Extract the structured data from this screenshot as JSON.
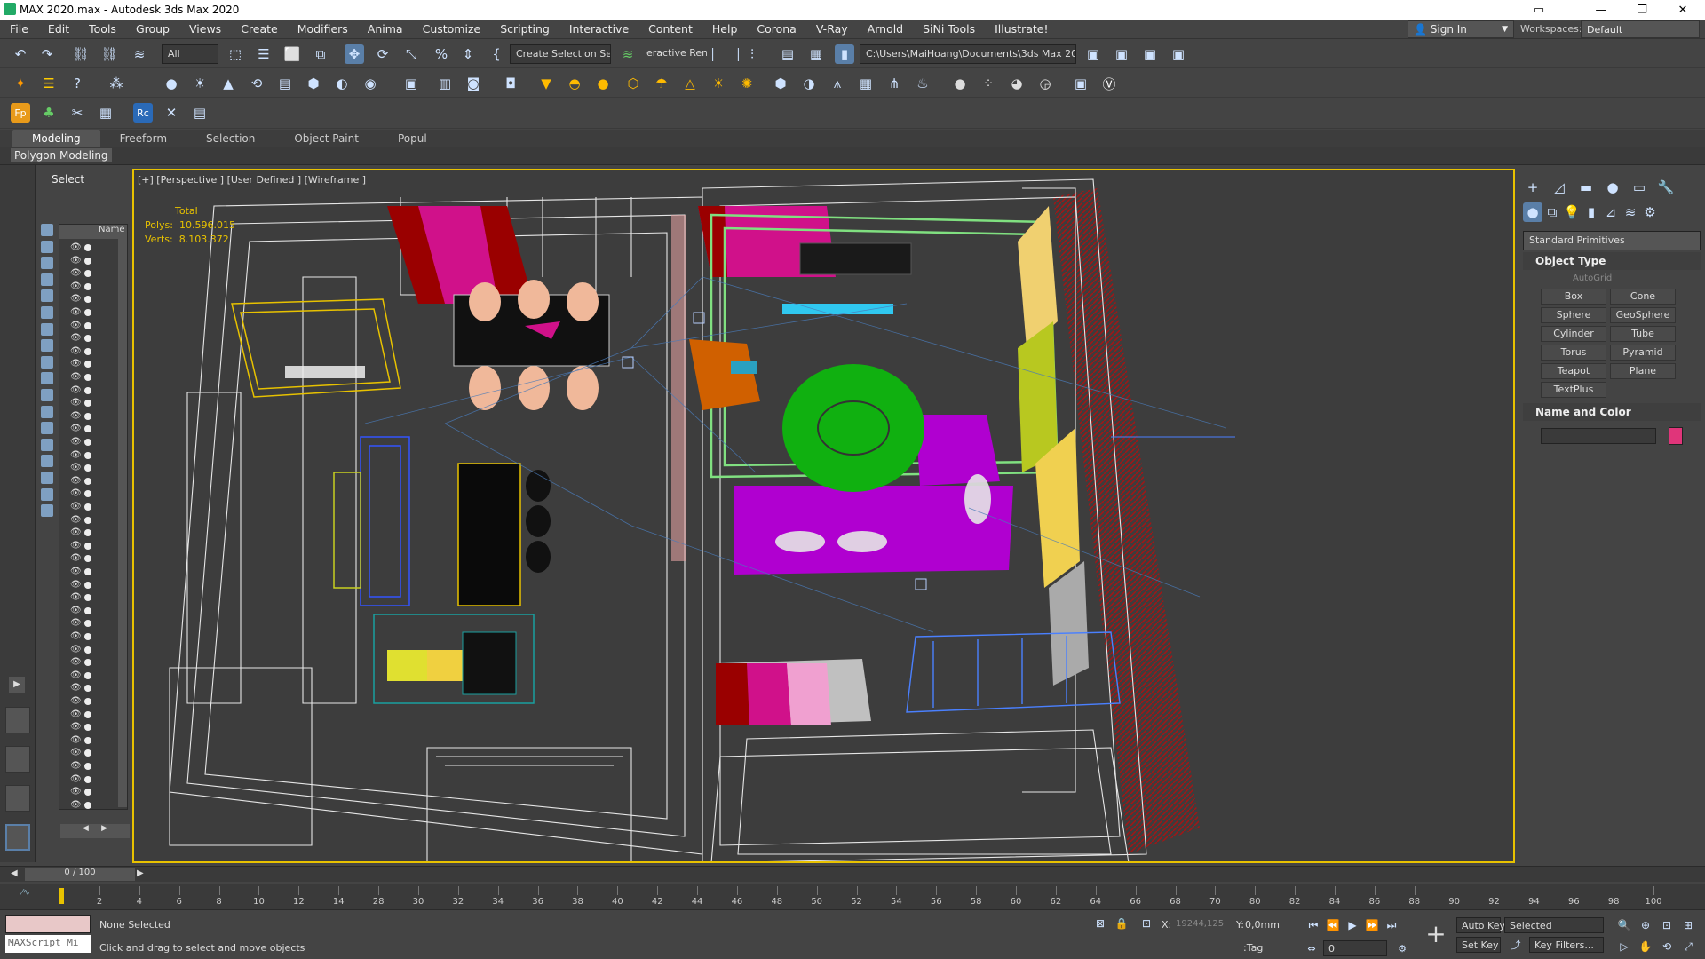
{
  "window": {
    "title": "MAX 2020.max - Autodesk 3ds Max 2020"
  },
  "menu": [
    "File",
    "Edit",
    "Tools",
    "Group",
    "Views",
    "Create",
    "Modifiers",
    "Anima",
    "Customize",
    "Scripting",
    "Interactive",
    "Content",
    "Help",
    "Corona",
    "V-Ray",
    "Arnold",
    "SiNi Tools",
    "Illustrate!"
  ],
  "account": {
    "signin": "Sign In",
    "workspaces_label": "Workspaces:",
    "workspace": "Default"
  },
  "toolbar": {
    "filter": "All",
    "selection_set": "Create Selection Se",
    "interactive": "eractive Rend",
    "path": "C:\\Users\\MaiHoang\\Documents\\3ds Max 2020"
  },
  "ribbon": {
    "tabs": [
      "Modeling",
      "Freeform",
      "Selection",
      "Object Paint",
      "Popul"
    ],
    "active": "Modeling",
    "panel": "Polygon Modeling"
  },
  "scene_explorer": {
    "title": "Select",
    "column": "Name (Sorted A"
  },
  "viewport": {
    "label": "[+] [Perspective ] [User Defined ] [Wireframe ]",
    "stats": {
      "total": "Total",
      "polys_label": "Polys:",
      "polys": "10.596.015",
      "verts_label": "Verts:",
      "verts": "8.103.372"
    }
  },
  "command_panel": {
    "category": "Standard Primitives",
    "object_type": "Object Type",
    "autogrid": "AutoGrid",
    "buttons": [
      "Box",
      "Cone",
      "Sphere",
      "GeoSphere",
      "Cylinder",
      "Tube",
      "Torus",
      "Pyramid",
      "Teapot",
      "Plane",
      "TextPlus"
    ],
    "name_and_color": "Name and Color",
    "color": "#e0357a"
  },
  "timeline": {
    "frame": "0 / 100",
    "ticks": [
      "2",
      "4",
      "6",
      "8",
      "10",
      "12",
      "14",
      "28",
      "30",
      "32",
      "34",
      "36",
      "38",
      "40",
      "42",
      "44",
      "46",
      "48",
      "50",
      "52",
      "54",
      "56",
      "58",
      "60",
      "62",
      "64",
      "66",
      "68",
      "70",
      "80",
      "82",
      "84",
      "86",
      "88",
      "90",
      "92",
      "94",
      "96",
      "98",
      "100"
    ]
  },
  "status": {
    "maxscript": "MAXScript Mi",
    "selection": "None Selected",
    "prompt": "Click and drag to select and move objects",
    "x_label": "X:",
    "x_value": "19244,125",
    "y_label": "Y:",
    "y_value": "0,0mm",
    "tag": "Tag",
    "auto_key": "Auto Key",
    "auto_key_mode": "Selected",
    "set_key": "Set Key",
    "key_filters": "Key Filters...",
    "current_frame": "0"
  }
}
